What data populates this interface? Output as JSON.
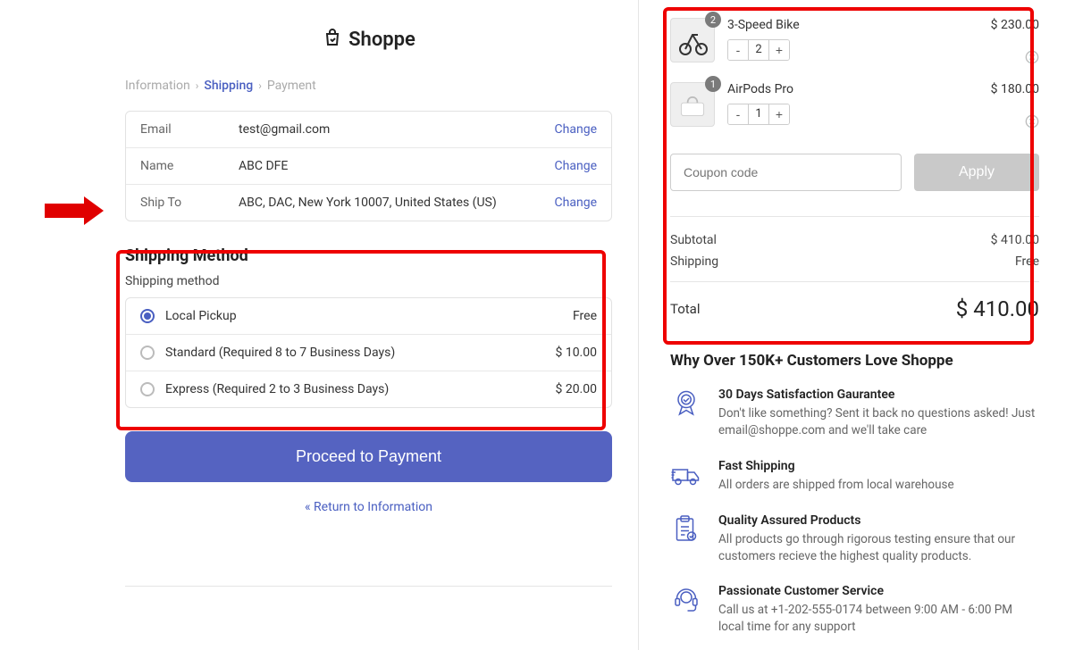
{
  "logo_text": "Shoppe",
  "breadcrumb": {
    "info": "Information",
    "shipping": "Shipping",
    "payment": "Payment"
  },
  "info": {
    "email_label": "Email",
    "email_value": "test@gmail.com",
    "name_label": "Name",
    "name_value": "ABC DFE",
    "shipto_label": "Ship To",
    "shipto_value": "ABC, DAC, New York 10007, United States (US)",
    "change": "Change"
  },
  "shipping": {
    "title": "Shipping Method",
    "sub": "Shipping method",
    "options": [
      {
        "name": "Local Pickup",
        "price": "Free",
        "selected": true
      },
      {
        "name": "Standard (Required 8 to 7 Business Days)",
        "price": "$ 10.00",
        "selected": false
      },
      {
        "name": "Express (Required 2 to 3 Business Days)",
        "price": "$ 20.00",
        "selected": false
      }
    ]
  },
  "proceed_label": "Proceed to Payment",
  "return_label": "« Return to Information",
  "cart": {
    "items": [
      {
        "name": "3-Speed Bike",
        "qty": "2",
        "price": "$ 230.00"
      },
      {
        "name": "AirPods Pro",
        "qty": "1",
        "price": "$ 180.00"
      }
    ],
    "coupon_placeholder": "Coupon code",
    "apply_label": "Apply",
    "subtotal_label": "Subtotal",
    "subtotal_value": "$ 410.00",
    "shipping_label": "Shipping",
    "shipping_value": "Free",
    "total_label": "Total",
    "total_value": "$ 410.00"
  },
  "why": {
    "title": "Why Over 150K+ Customers Love Shoppe",
    "benefits": [
      {
        "title": "30 Days Satisfaction Gaurantee",
        "desc": "Don't like something? Sent it back no questions asked! Just email@shoppe.com and we'll take care"
      },
      {
        "title": "Fast Shipping",
        "desc": "All orders are shipped from local warehouse"
      },
      {
        "title": "Quality Assured Products",
        "desc": "All products go through rigorous testing ensure that our customers recieve the highest quality products."
      },
      {
        "title": "Passionate Customer Service",
        "desc": "Call us at +1-202-555-0174 between 9:00 AM - 6:00 PM local time for any support"
      }
    ]
  }
}
